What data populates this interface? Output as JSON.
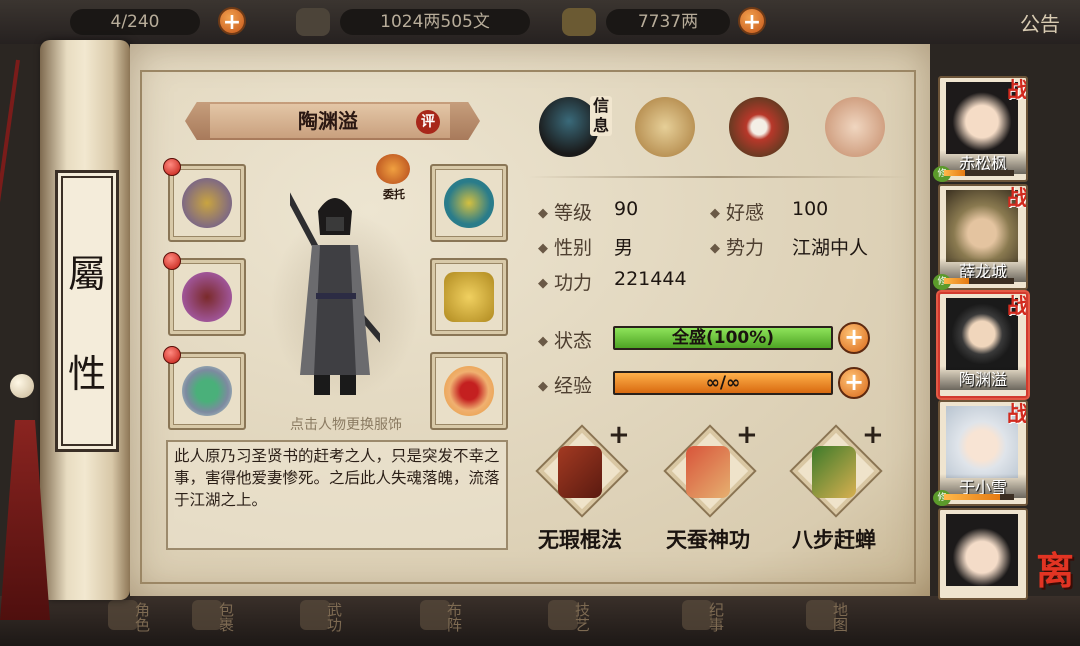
{
  "topbar": {
    "bag_count": "4/240",
    "silver": "1024两505文",
    "gold": "7737两",
    "notice": "公告"
  },
  "side_scroll": {
    "title_chars": [
      "屬",
      "性"
    ]
  },
  "hero": {
    "name": "陶渊溢",
    "evaluate": "评",
    "delegate": "委托",
    "hint": "点击人物更换服饰",
    "bio": "此人原乃习圣贤书的赶考之人，只是突发不幸之事，害得他爱妻惨死。之后此人失魂落魄，流落于江湖之上。"
  },
  "tabs": [
    {
      "name": "info",
      "label": "信息",
      "active": true
    },
    {
      "name": "scroll",
      "label": ""
    },
    {
      "name": "bagua",
      "label": ""
    },
    {
      "name": "meridian",
      "label": ""
    }
  ],
  "stats": {
    "level_label": "等级",
    "level": "90",
    "affinity_label": "好感",
    "affinity": "100",
    "gender_label": "性别",
    "gender": "男",
    "faction_label": "势力",
    "faction": "江湖中人",
    "power_label": "功力",
    "power": "221444",
    "status_label": "状态",
    "status_text": "全盛(100%)",
    "status_fill": 1.0,
    "exp_label": "经验",
    "exp_text": "∞/∞",
    "exp_fill": 1.0
  },
  "skills": [
    {
      "name": "无瑕棍法",
      "plus": "+"
    },
    {
      "name": "天蚕神功",
      "plus": "+"
    },
    {
      "name": "八步赶蝉",
      "plus": "+"
    }
  ],
  "roster": [
    {
      "name": "赤松枫",
      "badge": "战",
      "tag": "修",
      "hp": 0.3
    },
    {
      "name": "薛龙城",
      "badge": "战",
      "tag": "修",
      "hp": 0.35
    },
    {
      "name": "陶渊溢",
      "badge": "战",
      "tag": "",
      "hp": 0.0,
      "selected": true
    },
    {
      "name": "于小雪",
      "badge": "战",
      "tag": "修",
      "hp": 0.8
    },
    {
      "name": "",
      "badge": "",
      "tag": "",
      "hp": 0.0
    }
  ],
  "leave_label": "离",
  "bottom_nav": [
    "角色",
    "包裹",
    "武功",
    "布阵",
    "技艺",
    "纪事",
    "地图"
  ],
  "colors": {
    "status_bar": "#6cc23a",
    "exp_bar": "#ef8a1e",
    "accent_red": "#c01a10",
    "parchment": "#e6dcc4"
  }
}
